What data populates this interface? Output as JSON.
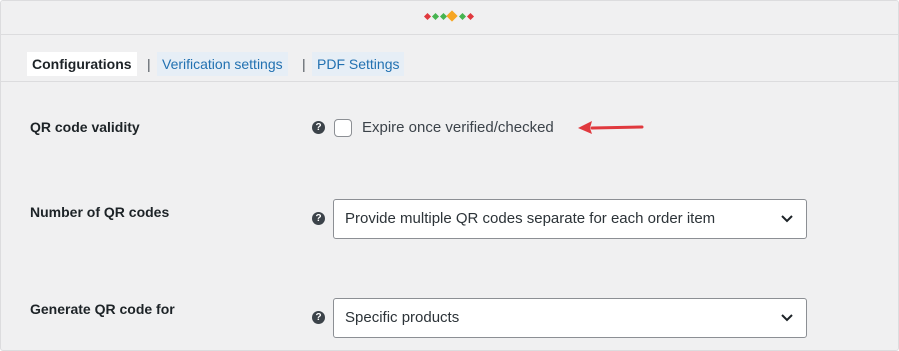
{
  "tabs": [
    {
      "label": "Configurations",
      "active": true
    },
    {
      "label": "Verification settings",
      "active": false
    },
    {
      "label": "PDF Settings",
      "active": false
    }
  ],
  "tab_separator": "|",
  "settings": {
    "qr_validity": {
      "label": "QR code validity",
      "help_icon": "question-circle-icon",
      "checkbox_label": "Expire once verified/checked",
      "checked": false
    },
    "number_of_codes": {
      "label": "Number of QR codes",
      "help_icon": "question-circle-icon",
      "selected": "Provide multiple QR codes separate for each order item"
    },
    "generate_for": {
      "label": "Generate QR code for",
      "help_icon": "question-circle-icon",
      "selected": "Specific products"
    }
  },
  "help_glyph": "?",
  "colors": {
    "accent_link": "#2271b1",
    "arrow": "#e0393e",
    "dot_red": "#e0393e",
    "dot_orange": "#f6a623",
    "dot_green": "#46b450"
  }
}
